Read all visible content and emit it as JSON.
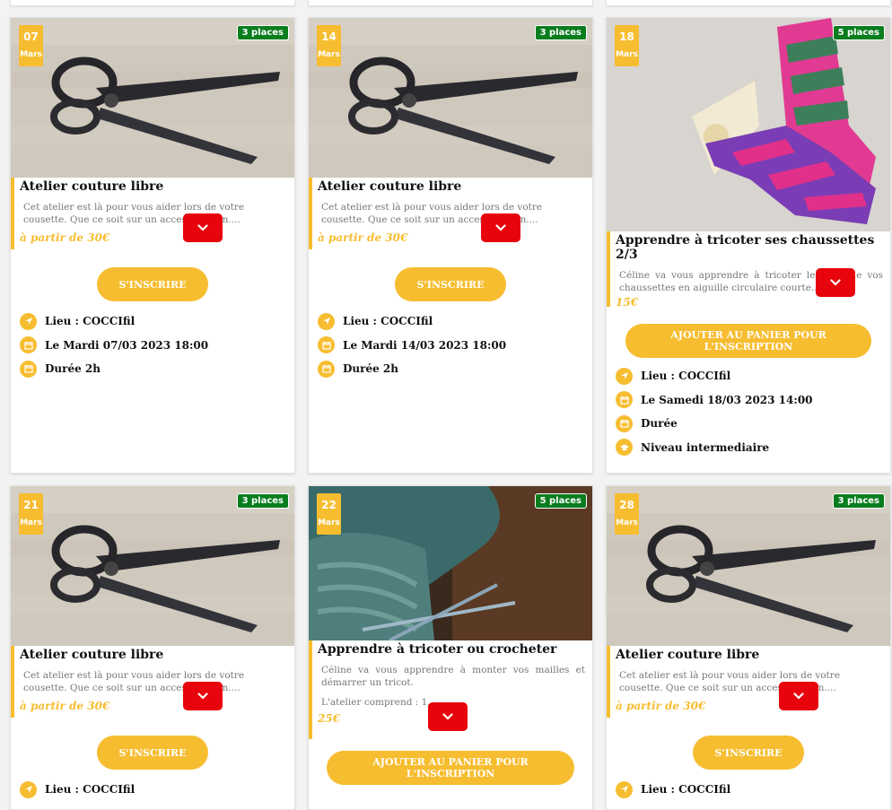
{
  "cards": [
    {
      "day": "07",
      "month": "Mars",
      "places": "3 places",
      "title": "Atelier couture libre",
      "desc": "Cet atelier est là pour vous aider lors de votre cousette. Que ce soit sur un accessoire, un....",
      "price": "à partir de 30€",
      "button": "S'INSCRIRE",
      "lieu": "Lieu : COCCIfil",
      "date": "Le Mardi 07/03 2023 18:00",
      "duree": "Durée 2h"
    },
    {
      "day": "14",
      "month": "Mars",
      "places": "3 places",
      "title": "Atelier couture libre",
      "desc": "Cet atelier est là pour vous aider lors de votre cousette. Que ce soit sur un accessoire, un....",
      "price": "à partir de 30€",
      "button": "S'INSCRIRE",
      "lieu": "Lieu : COCCIfil",
      "date": "Le Mardi 14/03 2023 18:00",
      "duree": "Durée 2h"
    },
    {
      "day": "18",
      "month": "Mars",
      "places": "5 places",
      "title": "Apprendre à tricoter ses chaussettes 2/3",
      "desc": "Céline va vous apprendre à tricoter le talon de vos chaussettes en aiguille circulaire courte....",
      "price": "15€",
      "button": "AJOUTER AU PANIER POUR L'INSCRIPTION",
      "lieu": "Lieu : COCCIfil",
      "date": "Le Samedi 18/03 2023 14:00",
      "duree": "Durée",
      "niveau": "Niveau intermediaire"
    },
    {
      "day": "21",
      "month": "Mars",
      "places": "3 places",
      "title": "Atelier couture libre",
      "desc": "Cet atelier est là pour vous aider lors de votre cousette. Que ce soit sur un accessoire, un....",
      "price": "à partir de 30€",
      "button": "S'INSCRIRE",
      "lieu": "Lieu : COCCIfil"
    },
    {
      "day": "22",
      "month": "Mars",
      "places": "5 places",
      "title": "Apprendre à tricoter ou crocheter",
      "desc": "Céline va vous apprendre à monter vos mailles et démarrer un tricot.",
      "desc2": "L'atelier comprend : 1....",
      "price": "25€",
      "button": "AJOUTER AU PANIER POUR L'INSCRIPTION"
    },
    {
      "day": "28",
      "month": "Mars",
      "places": "3 places",
      "title": "Atelier couture libre",
      "desc": "Cet atelier est là pour vous aider lors de votre cousette. Que ce soit sur un accessoire, un....",
      "price": "à partir de 30€",
      "button": "S'INSCRIRE",
      "lieu": "Lieu : COCCIfil"
    }
  ],
  "colors": {
    "accent": "#f7bd30",
    "places_green": "#0a7d1e",
    "more_red": "#e8040c"
  },
  "icons": {
    "more": "chevron-down-icon",
    "lieu": "location-arrow-icon",
    "date": "calendar-icon",
    "duree": "calendar-icon",
    "niveau": "graduation-cap-icon"
  }
}
